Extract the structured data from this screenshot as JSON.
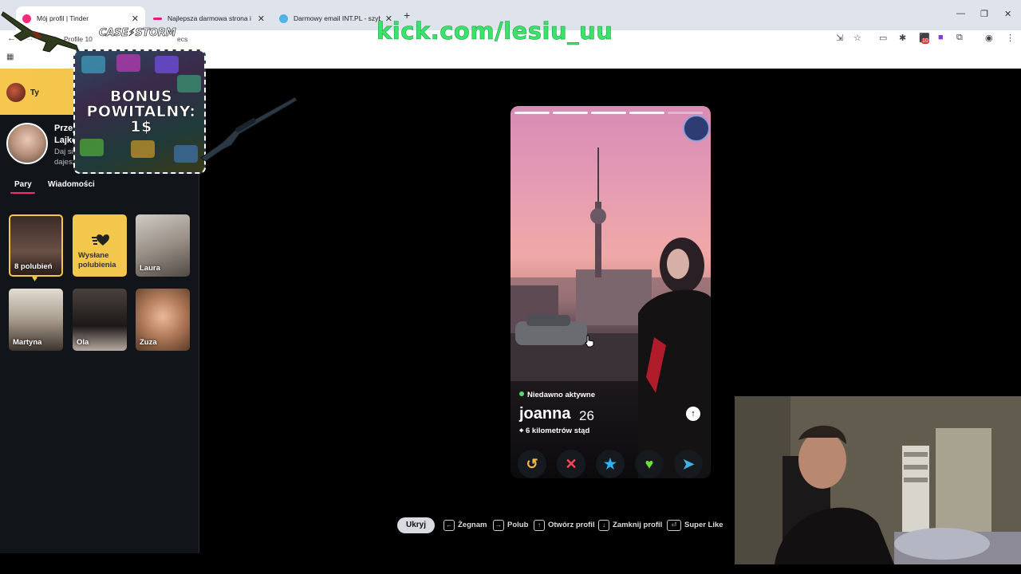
{
  "browser": {
    "tabs": [
      {
        "title": "Mój profil | Tinder",
        "favicon_color": "#fd297b"
      },
      {
        "title": "Najlepsza darmowa strona i apli",
        "favicon_color": "#e6197a"
      },
      {
        "title": "Darmowy email INT.PL - szybka",
        "favicon_color": "#4fb3e8"
      }
    ],
    "profile_label": "Profile 10",
    "url_fragment": "ecs",
    "extension_badge": "10"
  },
  "overlays": {
    "kick_text": "kick.com/lesiu_uu",
    "brand": "CASE⚡STORM",
    "bonus_text": "BONUS POWITALNY: 1$"
  },
  "sidebar": {
    "you_label": "Ty",
    "profile_title_line1": "Przej",
    "profile_title_line2": "Lajko",
    "profile_sub_line1": "Daj si",
    "profile_sub_line2": "dajesz",
    "tabs": [
      {
        "label": "Pary",
        "active": true
      },
      {
        "label": "Wiadomości",
        "active": false
      }
    ],
    "cards": [
      {
        "name": "8 polubień",
        "type": "likes"
      },
      {
        "name": "Wysłane polubienia",
        "type": "sent"
      },
      {
        "name": "Laura"
      },
      {
        "name": "Martyna"
      },
      {
        "name": "Ola"
      },
      {
        "name": "Zuza"
      }
    ]
  },
  "profile": {
    "status": "Niedawno aktywne",
    "name": "joanna",
    "age": "26",
    "distance": "6 kilometrów stąd",
    "info_icon": "arrow-up-icon",
    "photos_total": 5,
    "photo_current": 4,
    "actions": [
      {
        "name": "rewind-button",
        "glyph": "↺",
        "color": "#f5b748"
      },
      {
        "name": "nope-button",
        "glyph": "✕",
        "color": "#ff4458"
      },
      {
        "name": "super-like-button",
        "glyph": "★",
        "color": "#2db3f5"
      },
      {
        "name": "like-button",
        "glyph": "♥",
        "color": "#6ee038"
      },
      {
        "name": "boost-button",
        "glyph": "➤",
        "color": "#3db0e8"
      }
    ]
  },
  "hints": {
    "hide": "Ukryj",
    "items": [
      {
        "key": "←",
        "label": "Żegnam"
      },
      {
        "key": "→",
        "label": "Polub"
      },
      {
        "key": "↑",
        "label": "Otwórz profil"
      },
      {
        "key": "↓",
        "label": "Zamknij profil"
      },
      {
        "key": "⏎",
        "label": "Super Like"
      }
    ]
  }
}
